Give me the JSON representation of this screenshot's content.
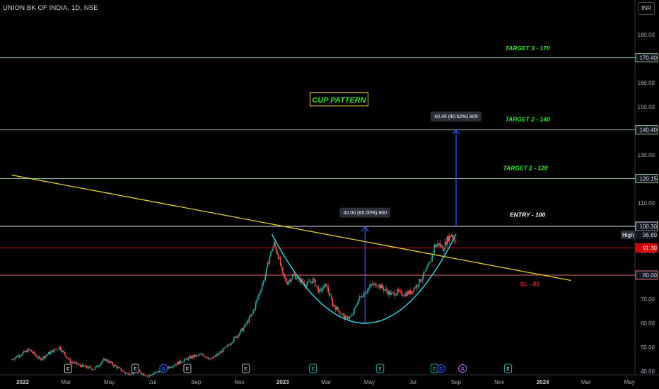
{
  "header": {
    "symbol": "UNION BK OF INDIA, 1D, NSE",
    "currency": "INR"
  },
  "chart_data": {
    "type": "line",
    "ylim": [
      40,
      190
    ],
    "y_ticks": [
      40,
      50,
      60,
      70,
      80,
      90,
      100,
      110,
      120,
      130,
      140,
      150,
      160,
      170,
      180
    ],
    "time_labels": [
      {
        "label": "2022",
        "t": 0,
        "year": true
      },
      {
        "label": "Mar",
        "t": 2
      },
      {
        "label": "May",
        "t": 4
      },
      {
        "label": "Jul",
        "t": 6
      },
      {
        "label": "Sep",
        "t": 8
      },
      {
        "label": "Nov",
        "t": 10
      },
      {
        "label": "2023",
        "t": 12,
        "year": true
      },
      {
        "label": "Mar",
        "t": 14
      },
      {
        "label": "May",
        "t": 16
      },
      {
        "label": "Jul",
        "t": 18
      },
      {
        "label": "Sep",
        "t": 20
      },
      {
        "label": "Nov",
        "t": 22
      },
      {
        "label": "2024",
        "t": 24,
        "year": true
      },
      {
        "label": "Mar",
        "t": 26
      },
      {
        "label": "May",
        "t": 28
      }
    ],
    "price_path": [
      [
        -0.5,
        45
      ],
      [
        0.3,
        49
      ],
      [
        0.8,
        45
      ],
      [
        1.3,
        48
      ],
      [
        1.7,
        50
      ],
      [
        2.2,
        44
      ],
      [
        2.8,
        42
      ],
      [
        3.3,
        41
      ],
      [
        3.8,
        45
      ],
      [
        4.3,
        42
      ],
      [
        4.8,
        39
      ],
      [
        5.3,
        40
      ],
      [
        5.8,
        38
      ],
      [
        6.3,
        40
      ],
      [
        6.8,
        42
      ],
      [
        7.3,
        44
      ],
      [
        7.8,
        46
      ],
      [
        8.3,
        47
      ],
      [
        8.7,
        45
      ],
      [
        9.0,
        47
      ],
      [
        9.4,
        50
      ],
      [
        9.8,
        54
      ],
      [
        10.2,
        58
      ],
      [
        10.6,
        64
      ],
      [
        10.9,
        72
      ],
      [
        11.2,
        80
      ],
      [
        11.4,
        88
      ],
      [
        11.6,
        93
      ],
      [
        11.8,
        88
      ],
      [
        12.0,
        80
      ],
      [
        12.2,
        77
      ],
      [
        12.5,
        80
      ],
      [
        12.8,
        78
      ],
      [
        13.1,
        76
      ],
      [
        13.4,
        78
      ],
      [
        13.7,
        73
      ],
      [
        14.0,
        76
      ],
      [
        14.3,
        68
      ],
      [
        14.6,
        65
      ],
      [
        14.9,
        62
      ],
      [
        15.2,
        63
      ],
      [
        15.5,
        70
      ],
      [
        15.8,
        73
      ],
      [
        16.1,
        76
      ],
      [
        16.4,
        76
      ],
      [
        16.7,
        74
      ],
      [
        17.0,
        72
      ],
      [
        17.3,
        73
      ],
      [
        17.6,
        72
      ],
      [
        17.9,
        73
      ],
      [
        18.2,
        76
      ],
      [
        18.5,
        80
      ],
      [
        18.8,
        85
      ],
      [
        19.0,
        92
      ],
      [
        19.2,
        93
      ],
      [
        19.4,
        91
      ],
      [
        19.6,
        95
      ],
      [
        19.8,
        97
      ],
      [
        20.0,
        93
      ]
    ],
    "horizontal_levels": [
      {
        "value": 170.4,
        "label": "170.40",
        "color": "#8fbf8f"
      },
      {
        "value": 140.4,
        "label": "140.40",
        "color": "#8fbf8f"
      },
      {
        "value": 120.15,
        "label": "120.15",
        "color": "#8fbf8f"
      },
      {
        "value": 100.3,
        "label": "100.30",
        "color": "#e0e0e0"
      },
      {
        "value": 91.3,
        "label": "91.30",
        "color": "#d10a0a"
      },
      {
        "value": 80.0,
        "label": "80.00",
        "color": "#e07070"
      }
    ],
    "last_price": {
      "value": 91.3,
      "label": "91.30",
      "color": "#d50000"
    },
    "high_marker": {
      "label": "High",
      "value": 96.8,
      "value_label": "96.80"
    },
    "trendline": {
      "from": [
        -0.5,
        121.6
      ],
      "to": [
        25.3,
        77.8
      ],
      "color": "#e8d230"
    },
    "cup_curve": {
      "left": [
        11.5,
        97
      ],
      "bottom": [
        15.8,
        60
      ],
      "right": [
        20.0,
        97
      ],
      "color": "#38d9e8"
    },
    "annotations": [
      {
        "text": "TARGET 3 - 170",
        "t": 23.3,
        "value": 173.5,
        "color": "#2ee82e"
      },
      {
        "text": "TARGET 2 - 140",
        "t": 23.3,
        "value": 144.0,
        "color": "#2ee82e"
      },
      {
        "text": "TARGET 1 - 120",
        "t": 23.2,
        "value": 123.7,
        "color": "#2ee82e"
      },
      {
        "text": "ENTRY  - 100",
        "t": 23.3,
        "value": 104.3,
        "color": "#ffffff"
      },
      {
        "text": "SL - 80",
        "t": 23.4,
        "value": 75.5,
        "color": "#e81e1e"
      }
    ],
    "pattern_label": {
      "text": "CUP PATTERN",
      "t": 14.6,
      "value": 153.0
    },
    "measurements": [
      {
        "text": "40.00 (66.00%) 800",
        "t": 15.8,
        "from": 60,
        "to": 100,
        "label_value": 106
      },
      {
        "text": "40.45 (40.52%) 809",
        "t": 20.0,
        "from": 100,
        "to": 140.4,
        "label_value": 146
      }
    ],
    "events": [
      {
        "t": 2.1,
        "kind": "E"
      },
      {
        "t": 5.2,
        "kind": "E"
      },
      {
        "t": 6.5,
        "kind": "D"
      },
      {
        "t": 7.6,
        "kind": "E"
      },
      {
        "t": 10.3,
        "kind": "E"
      },
      {
        "t": 13.4,
        "kind": "E"
      },
      {
        "t": 16.5,
        "kind": "E"
      },
      {
        "t": 19.0,
        "kind": "E"
      },
      {
        "t": 19.3,
        "kind": "D"
      },
      {
        "t": 20.3,
        "kind": "S"
      },
      {
        "t": 22.4,
        "kind": "E"
      }
    ]
  }
}
